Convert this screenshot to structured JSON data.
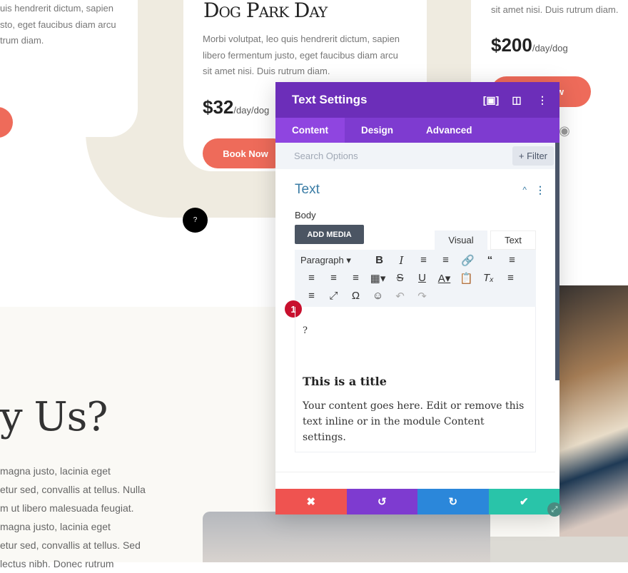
{
  "background": {
    "left_card_lines": [
      "uis hendrerit dictum, sapien",
      "sto, eget faucibus diam arcu",
      "trum diam."
    ],
    "center_card": {
      "title": "Dog Park Day",
      "lines": [
        "Morbi volutpat, leo quis hendrerit dictum, sapien",
        "libero fermentum justo, eget faucibus diam arcu",
        "sit amet nisi. Duis rutrum diam."
      ],
      "price": "$32",
      "unit": "/day/dog",
      "button": "Book Now"
    },
    "right_card": {
      "line": "sit amet nisi. Duis rutrum diam.",
      "price": "$200",
      "unit": "/day/dog",
      "button": "w"
    },
    "help_marker": "?",
    "why_title": "y Us?",
    "why_lines": [
      "magna justo, lacinia eget",
      "etur sed, convallis at tellus. Nulla",
      "m ut libero malesuada feugiat.",
      "magna justo, lacinia eget",
      "etur sed, convallis at tellus. Sed",
      "lectus nibh. Donec rutrum"
    ]
  },
  "dialog": {
    "title": "Text Settings",
    "tabs": [
      {
        "label": "Content",
        "active": true
      },
      {
        "label": "Design"
      },
      {
        "label": "Advanced"
      }
    ],
    "search_placeholder": "Search Options",
    "filter_label": "+ Filter",
    "section_title": "Text",
    "body_label": "Body",
    "add_media": "ADD MEDIA",
    "editor_tabs": [
      "Visual",
      "Text"
    ],
    "format_select": "Paragraph",
    "badge": "1",
    "content": {
      "char": "?",
      "heading": "This is a title",
      "paragraph": "Your content goes here. Edit or remove this text inline or in the module Content settings."
    },
    "colors": {
      "header": "#6c2eb9",
      "tabs": "#7e3bd0",
      "cancel": "#ef5350",
      "undo": "#7e3bd0",
      "redo": "#2b87da",
      "save": "#29c4a9"
    }
  }
}
